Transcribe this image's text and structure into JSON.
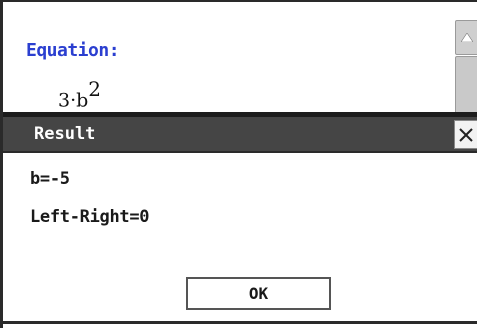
{
  "background": {
    "equation_label": "Equation:",
    "equation_base": "3·b",
    "equation_exponent": "2"
  },
  "dialog": {
    "title": "Result",
    "close_glyph": "×",
    "lines": [
      "b=-5",
      "Left-Right=0"
    ],
    "ok_label": "OK"
  },
  "icons": {
    "scroll_up": "triangle-up-icon",
    "close": "close-icon"
  },
  "colors": {
    "label_blue": "#2b3fd0",
    "titlebar": "#454545"
  }
}
